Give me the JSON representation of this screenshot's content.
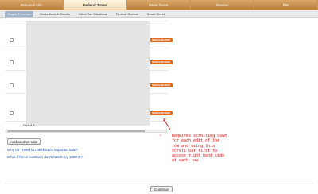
{
  "top_tabs": [
    {
      "label": "Personal Info"
    },
    {
      "label": "Federal Taxes"
    },
    {
      "label": "State Taxes"
    },
    {
      "label": "Review"
    },
    {
      "label": "File"
    }
  ],
  "sub_tabs": [
    {
      "label": "Wages & Income"
    },
    {
      "label": "Deductions & Credits"
    },
    {
      "label": "Other Tax Situations"
    },
    {
      "label": "Federal Review"
    },
    {
      "label": "Smart Check"
    }
  ],
  "rows": {
    "review_label": "NEEDS REVIEW",
    "ellipsis": "• • • • •"
  },
  "add_button": "Add another sale",
  "links": [
    "Why do I need to check each imported sale?",
    "What if these numbers don't match my 1099-B?"
  ],
  "annotation": "Requires scrolling down\nfor each edit of the\nrow and using this\nscroll bar first to\naccess right hand side\nof each row",
  "continue_button": "Continue",
  "colors": {
    "annotation": "#e01010",
    "review": "#e06a1b",
    "link": "#1a56b8"
  }
}
